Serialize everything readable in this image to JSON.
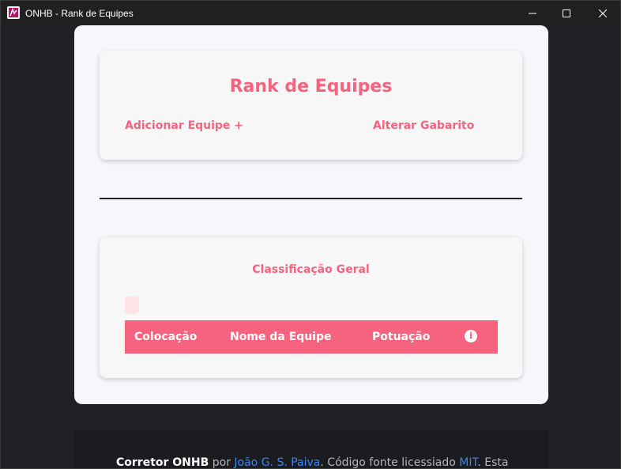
{
  "window": {
    "title": "ONHB - Rank de Equipes",
    "controls": [
      "minimize-icon",
      "maximize-icon",
      "close-icon"
    ]
  },
  "header": {
    "title": "Rank de Equipes",
    "add_team_label": "Adicionar Equipe +",
    "change_key_label": "Alterar Gabarito"
  },
  "ranking": {
    "section_title": "Classificação Geral",
    "columns": [
      "Colocação",
      "Nome da Equipe",
      "Potuação"
    ],
    "info_icon": "info-icon",
    "rows": []
  },
  "footer": {
    "app_name": "Corretor ONHB",
    "by_text": " por ",
    "author": "João G. S. Paiva",
    "license_text": ". Código fonte licessiado ",
    "license": "MIT",
    "trailing_text": ". Esta"
  },
  "colors": {
    "accent": "#f5637f",
    "card_bg": "#f6f7fb",
    "page_bg": "#1f2124",
    "link": "#3b82f6"
  }
}
